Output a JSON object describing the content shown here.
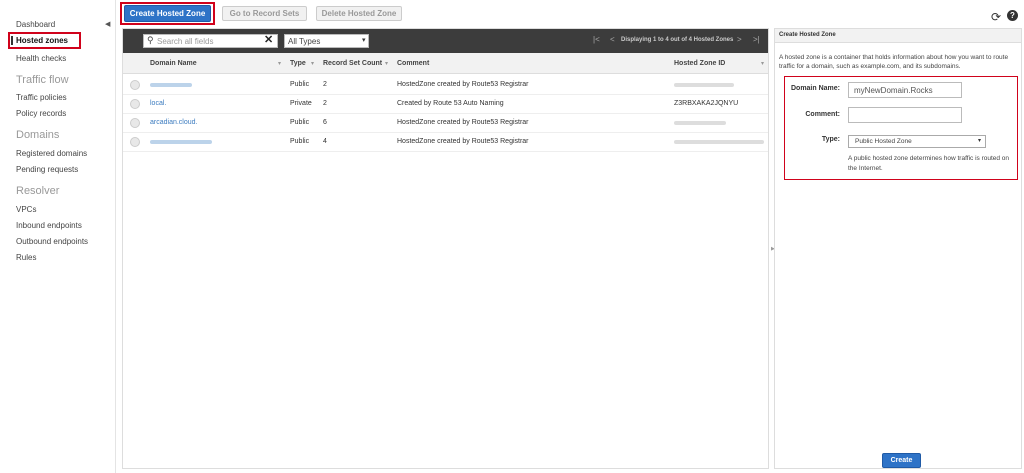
{
  "sidebar": {
    "dashboard": "Dashboard",
    "hosted_zones": "Hosted zones",
    "health_checks": "Health checks",
    "traffic_flow_heading": "Traffic flow",
    "traffic_policies": "Traffic policies",
    "policy_records": "Policy records",
    "domains_heading": "Domains",
    "registered_domains": "Registered domains",
    "pending_requests": "Pending requests",
    "resolver_heading": "Resolver",
    "vpcs": "VPCs",
    "inbound_endpoints": "Inbound endpoints",
    "outbound_endpoints": "Outbound endpoints",
    "rules": "Rules"
  },
  "toolbar": {
    "create_label": "Create Hosted Zone",
    "goto_label": "Go to Record Sets",
    "delete_label": "Delete Hosted Zone"
  },
  "filter": {
    "search_placeholder": "Search all fields",
    "type_value": "All Types",
    "pager_text": "Displaying 1 to 4 out of 4 Hosted Zones"
  },
  "table": {
    "columns": {
      "domain_name": "Domain Name",
      "type": "Type",
      "record_count": "Record Set Count",
      "comment": "Comment",
      "zone_id": "Hosted Zone ID"
    },
    "rows": [
      {
        "domain": "",
        "type": "Public",
        "count": "2",
        "comment": "HostedZone created by Route53 Registrar",
        "zone_id": ""
      },
      {
        "domain": "local.",
        "type": "Private",
        "count": "2",
        "comment": "Created by Route 53 Auto Naming",
        "zone_id": "Z3RBXAKA2JQNYU"
      },
      {
        "domain": "arcadian.cloud.",
        "type": "Public",
        "count": "6",
        "comment": "HostedZone created by Route53 Registrar",
        "zone_id": ""
      },
      {
        "domain": "",
        "type": "Public",
        "count": "4",
        "comment": "HostedZone created by Route53 Registrar",
        "zone_id": ""
      }
    ]
  },
  "panel": {
    "title": "Create Hosted Zone",
    "description": "A hosted zone is a container that holds information about how you want to route traffic for a domain, such as example.com, and its subdomains.",
    "domain_label": "Domain Name:",
    "domain_value": "myNewDomain.Rocks",
    "comment_label": "Comment:",
    "comment_value": "",
    "type_label": "Type:",
    "type_value": "Public Hosted Zone",
    "type_help": "A public hosted zone determines how traffic is routed on the Internet.",
    "submit_label": "Create"
  },
  "colors": {
    "accent": "#2e73c7",
    "highlight": "#d0021b",
    "link": "#3b7bbf",
    "toolbar_dark": "#3c3c3c"
  }
}
